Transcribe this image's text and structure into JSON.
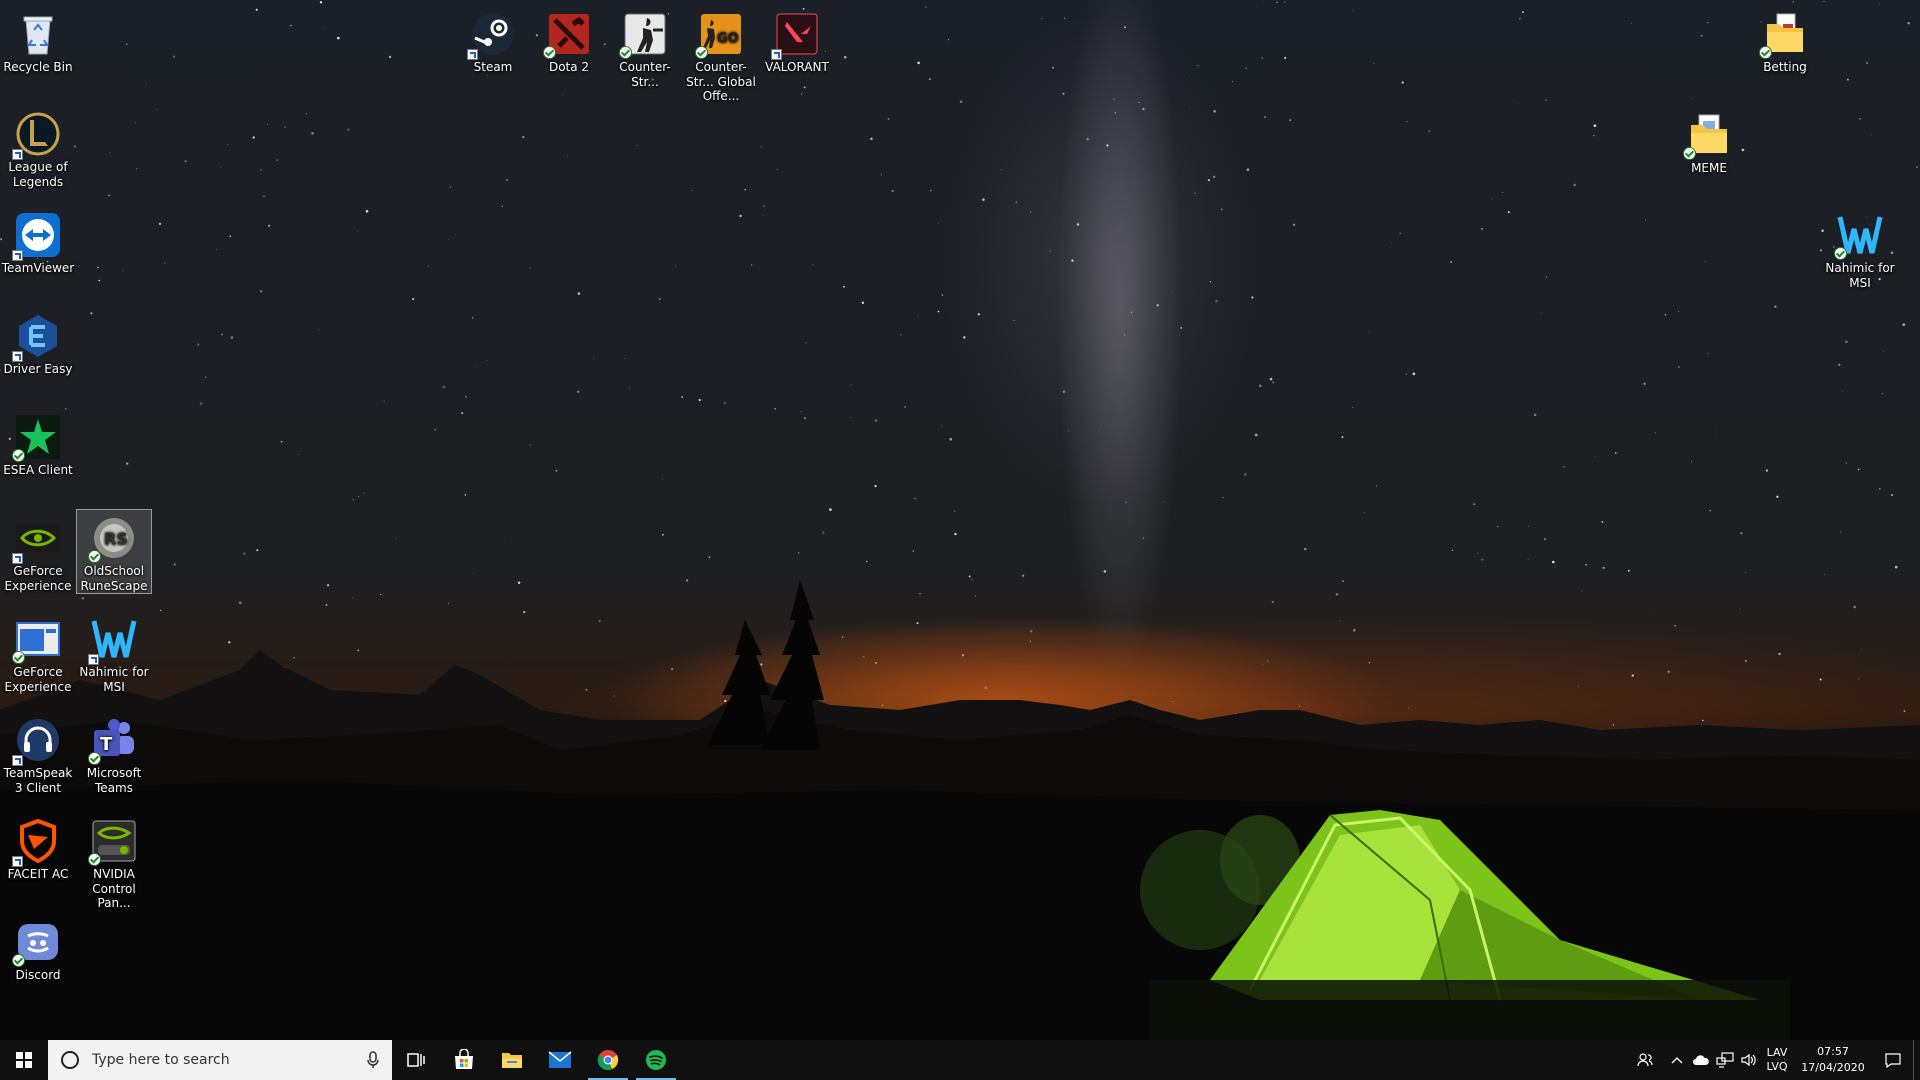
{
  "desktop": {
    "icons": {
      "recycle_bin": "Recycle Bin",
      "league": "League of Legends",
      "teamviewer": "TeamViewer",
      "driver_easy": "Driver Easy",
      "esea": "ESEA Client",
      "geforce1": "GeForce Experience",
      "oldschool": "OldSchool RuneScape",
      "geforce2": "GeForce Experience",
      "nahimic1": "Nahimic for MSI",
      "teamspeak": "TeamSpeak 3 Client",
      "teams": "Microsoft Teams",
      "faceit": "FACEIT AC",
      "nvidia_cp": "NVIDIA Control Pan...",
      "discord": "Discord",
      "steam": "Steam",
      "dota": "Dota 2",
      "cs": "Counter-Str...",
      "csgo": "Counter-Str... Global Offe...",
      "valorant": "VALORANT",
      "betting": "Betting",
      "meme": "MEME",
      "nahimic2": "Nahimic for MSI"
    }
  },
  "taskbar": {
    "search_placeholder": "Type here to search",
    "language_top": "LAV",
    "language_bottom": "LVQ",
    "time": "07:57",
    "date": "17/04/2020"
  },
  "colors": {
    "taskbar_bg": "#101010",
    "search_bg": "#f3f3f3",
    "accent": "#76b9ed",
    "spotify": "#1db954",
    "tent_green": "#8fd61f"
  }
}
